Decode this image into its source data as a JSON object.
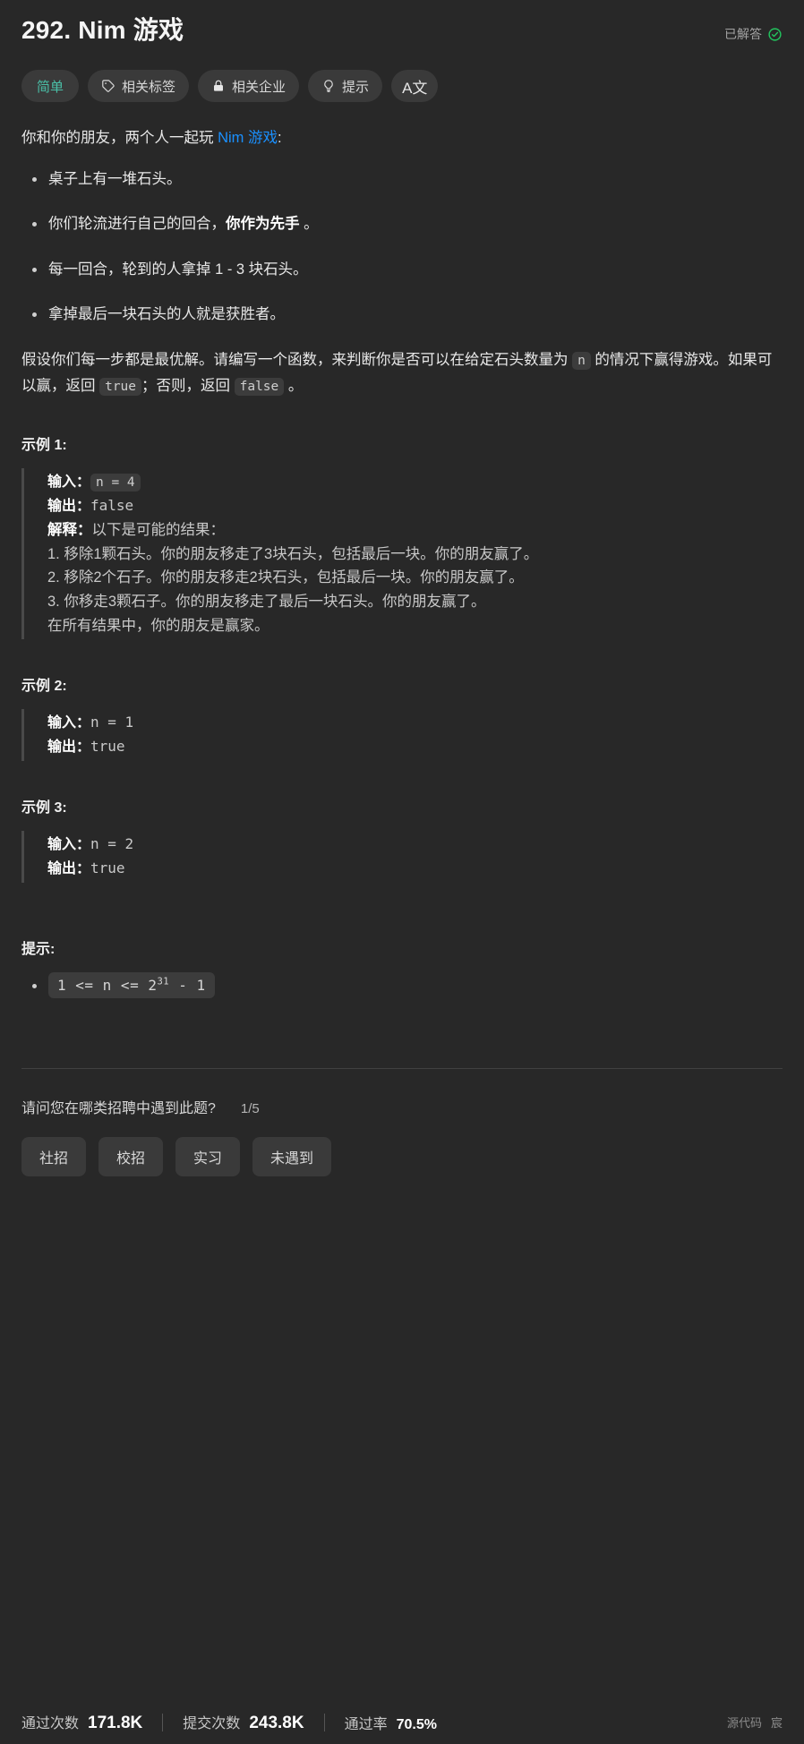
{
  "header": {
    "title": "292. Nim 游戏",
    "solved_label": "已解答",
    "solved_icon": "check-circle-icon"
  },
  "pills": [
    {
      "label": "简单",
      "icon": null,
      "kind": "difficulty"
    },
    {
      "label": "相关标签",
      "icon": "tag-icon",
      "kind": "normal"
    },
    {
      "label": "相关企业",
      "icon": "lock-icon",
      "kind": "normal"
    },
    {
      "label": "提示",
      "icon": "lightbulb-icon",
      "kind": "normal"
    },
    {
      "label": "A文",
      "icon": "translate-icon",
      "kind": "icon-only"
    }
  ],
  "description": {
    "intro_before": "你和你的朋友，两个人一起玩 ",
    "intro_link": "Nim 游戏",
    "intro_after": ":",
    "bullets": [
      {
        "text": "桌子上有一堆石头。",
        "bold": null,
        "tail": null
      },
      {
        "text": "你们轮流进行自己的回合，",
        "bold": "你作为先手",
        "tail": " 。"
      },
      {
        "text": "每一回合，轮到的人拿掉 1 - 3 块石头。",
        "bold": null,
        "tail": null
      },
      {
        "text": "拿掉最后一块石头的人就是获胜者。",
        "bold": null,
        "tail": null
      }
    ],
    "summary_part1": "假设你们每一步都是最优解。请编写一个函数，来判断你是否可以在给定石头数量为 ",
    "summary_code_n": "n",
    "summary_part2": " 的情况下赢得游戏。如果可以赢，返回 ",
    "summary_code_true": "true",
    "summary_part3": "；否则，返回 ",
    "summary_code_false": "false",
    "summary_part4": " 。"
  },
  "examples": [
    {
      "title": "示例 1:",
      "input_label": "输入：",
      "input_value": "n = 4",
      "input_is_chip": true,
      "output_label": "输出：",
      "output_value": "false",
      "explain_label": "解释：",
      "explain_head": "以下是可能的结果：",
      "explain_lines": [
        "1. 移除1颗石头。你的朋友移走了3块石头，包括最后一块。你的朋友赢了。",
        "2. 移除2个石子。你的朋友移走2块石头，包括最后一块。你的朋友赢了。",
        "3. 你移走3颗石子。你的朋友移走了最后一块石头。你的朋友赢了。",
        "在所有结果中，你的朋友是赢家。"
      ]
    },
    {
      "title": "示例 2:",
      "input_label": "输入：",
      "input_value": "n = 1",
      "input_is_chip": false,
      "output_label": "输出：",
      "output_value": "true",
      "explain_label": null,
      "explain_head": null,
      "explain_lines": []
    },
    {
      "title": "示例 3:",
      "input_label": "输入：",
      "input_value": "n = 2",
      "input_is_chip": false,
      "output_label": "输出：",
      "output_value": "true",
      "explain_label": null,
      "explain_head": null,
      "explain_lines": []
    }
  ],
  "hints": {
    "title": "提示:",
    "constraints": [
      {
        "prefix": "1 <= n <= 2",
        "sup": "31",
        "suffix": " - 1"
      }
    ]
  },
  "survey": {
    "question": "请问您在哪类招聘中遇到此题?",
    "counter": "1/5",
    "options": [
      "社招",
      "校招",
      "实习",
      "未遇到"
    ]
  },
  "stats": {
    "accepted_label": "通过次数",
    "accepted_value": "171.8K",
    "submissions_label": "提交次数",
    "submissions_value": "243.8K",
    "rate_label": "通过率",
    "rate_value": "70.5%"
  },
  "watermark": {
    "source": "源代码",
    "author": "宸"
  },
  "colors": {
    "background": "#282828",
    "accent_link": "#1a90ff",
    "difficulty_easy": "#4ac0a8",
    "solved_green": "#22c55e",
    "chip_bg": "#3c3c3c"
  }
}
